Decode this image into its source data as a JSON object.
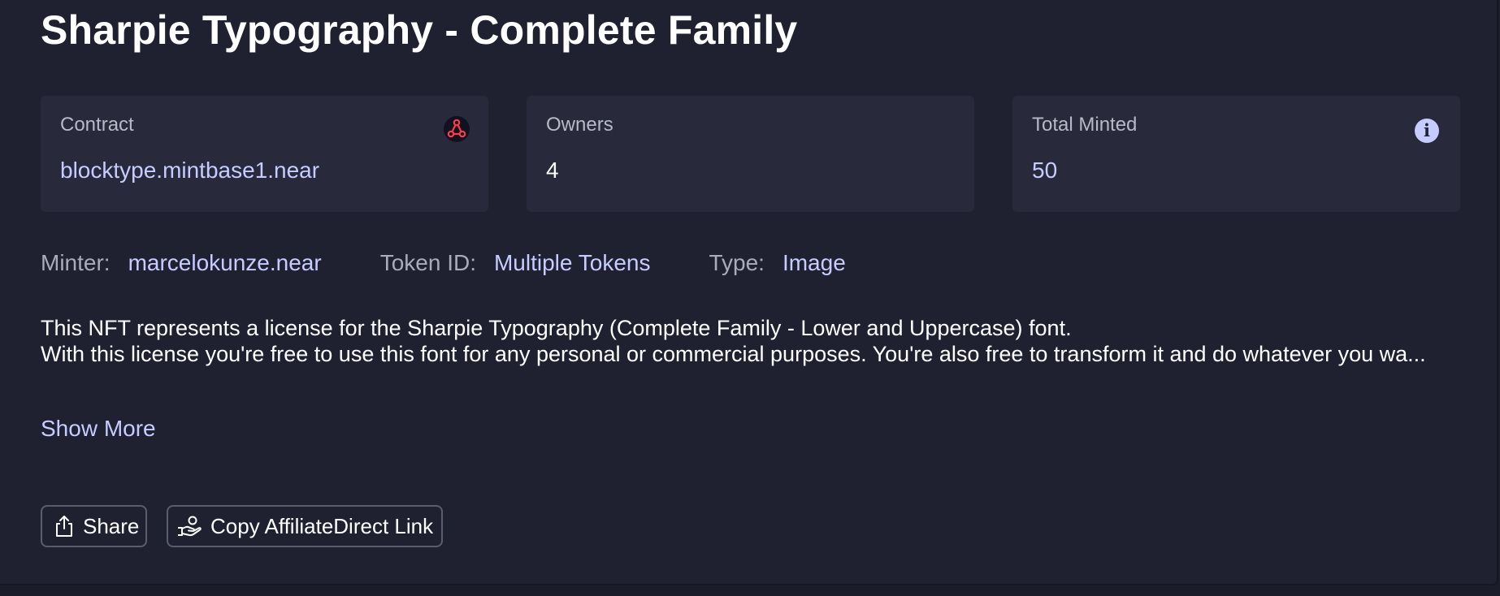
{
  "title": "Sharpie Typography - Complete Family",
  "cards": {
    "contract": {
      "label": "Contract",
      "value": "blocktype.mintbase1.near",
      "icon": "mintbase-contract-icon"
    },
    "owners": {
      "label": "Owners",
      "value": "4"
    },
    "minted": {
      "label": "Total Minted",
      "value": "50",
      "icon": "info-icon",
      "icon_glyph": "i"
    }
  },
  "meta": {
    "minter_label": "Minter:",
    "minter_value": "marcelokunze.near",
    "token_label": "Token ID:",
    "token_value": "Multiple Tokens",
    "type_label": "Type:",
    "type_value": "Image"
  },
  "description": {
    "line1": "This NFT represents a license for the Sharpie Typography (Complete Family - Lower and Uppercase) font.",
    "line2": "With this license you're free to use this font for any personal or commercial purposes. You're also free to transform it and do whatever you wa..."
  },
  "show_more": "Show More",
  "buttons": {
    "share": {
      "label": "Share",
      "icon": "share-icon"
    },
    "affiliate": {
      "label": "Copy AffiliateDirect Link",
      "icon": "hand-coin-icon"
    }
  },
  "colors": {
    "background": "#1b1d2b",
    "panel": "#1f2131",
    "card": "#282a3b",
    "accent": "#c6ccff",
    "muted": "#a9acb8",
    "contract_icon_red": "#ff3b4a"
  }
}
